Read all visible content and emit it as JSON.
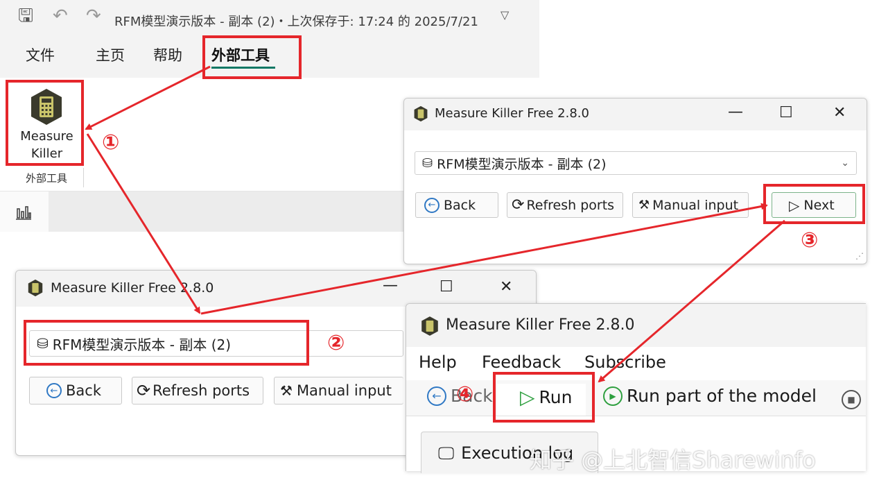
{
  "titlebar": {
    "doc_title": "RFM模型演示版本 - 副本 (2)・上次保存于: 17:24 的 2025/7/21",
    "icons": [
      "save-icon",
      "undo-icon",
      "redo-icon",
      "chevron-down-icon"
    ]
  },
  "ribbon": {
    "tabs": [
      {
        "label": "文件"
      },
      {
        "label": "主页"
      },
      {
        "label": "帮助"
      },
      {
        "label": "外部工具"
      }
    ],
    "button_label": "Measure Killer",
    "group_label": "外部工具"
  },
  "window1": {
    "title": "Measure Killer Free 2.8.0",
    "controls": {
      "minimize": "—",
      "maximize": "☐",
      "close": "✕"
    },
    "model_combo": "RFM模型演示版本 - 副本 (2)",
    "buttons": {
      "back": "Back",
      "refresh": "Refresh ports",
      "manual": "Manual input",
      "next": "Next"
    }
  },
  "window2": {
    "title": "Measure Killer Free 2.8.0",
    "controls": {
      "minimize": "—",
      "maximize": "☐",
      "close": "✕"
    },
    "model_combo": "RFM模型演示版本 - 副本 (2)",
    "buttons": {
      "back": "Back",
      "refresh": "Refresh ports",
      "manual": "Manual input"
    }
  },
  "window3": {
    "title": "Measure Killer Free 2.8.0",
    "menu": [
      "Help",
      "Feedback",
      "Subscribe"
    ],
    "toolbar": {
      "back": "Back",
      "run": "Run",
      "run_part": "Run part of the model"
    },
    "exec_tab": "Execution log"
  },
  "callouts": {
    "step1": "①",
    "step2": "②",
    "step3": "③",
    "step4": "④"
  },
  "watermark": "知乎 @上北智信Sharewinfo",
  "colors": {
    "highlight": "#e5262b",
    "accent_green": "#117865",
    "run_green": "#2e9f3f",
    "icon_blue": "#2f78c4"
  }
}
